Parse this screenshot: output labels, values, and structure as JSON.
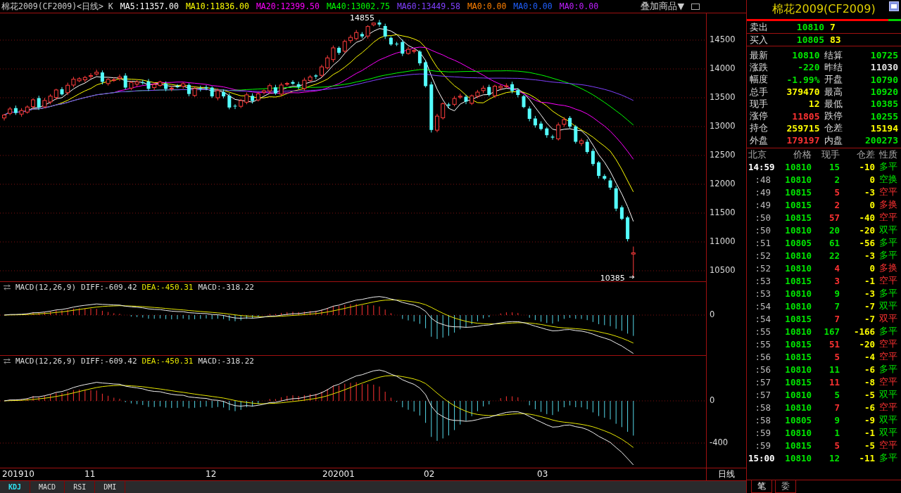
{
  "header": {
    "title": "棉花2009(CF2009)<日线> K",
    "moving_averages": [
      {
        "label": "MA5:11357.00",
        "color": "#ffffff"
      },
      {
        "label": "MA10:11836.00",
        "color": "#ffff00"
      },
      {
        "label": "MA20:12399.50",
        "color": "#ff00ff"
      },
      {
        "label": "MA40:13002.75",
        "color": "#00ff00"
      },
      {
        "label": "MA60:13449.58",
        "color": "#8040ff"
      },
      {
        "label": "MA0:0.00",
        "color": "#ff8000"
      },
      {
        "label": "MA0:0.00",
        "color": "#2060ff"
      },
      {
        "label": "MA0:0.00",
        "color": "#c020ff"
      }
    ],
    "overlay_button": "叠加商品▼"
  },
  "price_chart": {
    "y_ticks": [
      "14500",
      "14000",
      "13500",
      "13000",
      "12500",
      "12000",
      "11500",
      "11000",
      "10500"
    ],
    "high_marker": "14855",
    "low_marker": "10385"
  },
  "indicator_panes": [
    {
      "name": "MACD(12,26,9)",
      "diff": "DIFF:-609.42",
      "dea": "DEA:-450.31",
      "macd": "MACD:-318.22",
      "y_ticks": [
        "0"
      ]
    },
    {
      "name": "MACD(12,26,9)",
      "diff": "DIFF:-609.42",
      "dea": "DEA:-450.31",
      "macd": "MACD:-318.22",
      "y_ticks": [
        "0",
        "-400"
      ]
    }
  ],
  "x_axis": {
    "labels": [
      "201910",
      "11",
      "12",
      "202001",
      "02",
      "03"
    ],
    "period": "日线"
  },
  "indicator_tabs": [
    {
      "label": "KDJ",
      "selected": true
    },
    {
      "label": "MACD",
      "selected": false
    },
    {
      "label": "RSI",
      "selected": false
    },
    {
      "label": "DMI",
      "selected": false
    }
  ],
  "quote": {
    "title": "棉花2009(CF2009)",
    "ratio_bar": {
      "level": 0.92
    },
    "ask": {
      "label": "卖出",
      "price": "10810",
      "volume": "7"
    },
    "bid": {
      "label": "买入",
      "price": "10805",
      "volume": "83"
    },
    "stats": [
      {
        "label": "最新",
        "value": "10810",
        "color": "#00e600"
      },
      {
        "label": "结算",
        "value": "10725",
        "color": "#00e600"
      },
      {
        "label": "涨跌",
        "value": "-220",
        "color": "#00e600"
      },
      {
        "label": "昨结",
        "value": "11030",
        "color": "#e0e0e0"
      },
      {
        "label": "幅度",
        "value": "-1.99%",
        "color": "#00e600"
      },
      {
        "label": "开盘",
        "value": "10790",
        "color": "#00e600"
      },
      {
        "label": "总手",
        "value": "379470",
        "color": "#ffff00"
      },
      {
        "label": "最高",
        "value": "10920",
        "color": "#00e600"
      },
      {
        "label": "现手",
        "value": "12",
        "color": "#ffff00"
      },
      {
        "label": "最低",
        "value": "10385",
        "color": "#00e600"
      },
      {
        "label": "涨停",
        "value": "11805",
        "color": "#ff3232"
      },
      {
        "label": "跌停",
        "value": "10255",
        "color": "#00e600"
      },
      {
        "label": "持仓",
        "value": "259715",
        "color": "#ffff00"
      },
      {
        "label": "仓差",
        "value": "15194",
        "color": "#ffff00"
      },
      {
        "label": "外盘",
        "value": "179197",
        "color": "#ff3232"
      },
      {
        "label": "内盘",
        "value": "200273",
        "color": "#00e600"
      }
    ]
  },
  "ticks": {
    "columns": [
      "北京",
      "价格",
      "现手",
      "仓差",
      "性质"
    ],
    "rows": [
      {
        "time": "14:59",
        "price": "10810",
        "volume": "15",
        "oi_change": "-10",
        "nature": "多平",
        "color": "#00e600",
        "emphasis": true
      },
      {
        "time": ":48",
        "price": "10810",
        "volume": "2",
        "oi_change": "0",
        "nature": "空换",
        "color": "#00e600",
        "emphasis": false
      },
      {
        "time": ":49",
        "price": "10815",
        "volume": "5",
        "oi_change": "-3",
        "nature": "空平",
        "color": "#ff3232",
        "emphasis": false
      },
      {
        "time": ":49",
        "price": "10815",
        "volume": "2",
        "oi_change": "0",
        "nature": "多换",
        "color": "#ff3232",
        "emphasis": false
      },
      {
        "time": ":50",
        "price": "10815",
        "volume": "57",
        "oi_change": "-40",
        "nature": "空平",
        "color": "#ff3232",
        "emphasis": false
      },
      {
        "time": ":50",
        "price": "10810",
        "volume": "20",
        "oi_change": "-20",
        "nature": "双平",
        "color": "#00e600",
        "emphasis": false
      },
      {
        "time": ":51",
        "price": "10805",
        "volume": "61",
        "oi_change": "-56",
        "nature": "多平",
        "color": "#00e600",
        "emphasis": false
      },
      {
        "time": ":52",
        "price": "10810",
        "volume": "22",
        "oi_change": "-3",
        "nature": "多平",
        "color": "#00e600",
        "emphasis": false
      },
      {
        "time": ":52",
        "price": "10810",
        "volume": "4",
        "oi_change": "0",
        "nature": "多换",
        "color": "#ff3232",
        "emphasis": false
      },
      {
        "time": ":53",
        "price": "10815",
        "volume": "3",
        "oi_change": "-1",
        "nature": "空平",
        "color": "#ff3232",
        "emphasis": false
      },
      {
        "time": ":53",
        "price": "10810",
        "volume": "9",
        "oi_change": "-3",
        "nature": "多平",
        "color": "#00e600",
        "emphasis": false
      },
      {
        "time": ":54",
        "price": "10810",
        "volume": "7",
        "oi_change": "-7",
        "nature": "双平",
        "color": "#00e600",
        "emphasis": false
      },
      {
        "time": ":54",
        "price": "10815",
        "volume": "7",
        "oi_change": "-7",
        "nature": "双平",
        "color": "#ff3232",
        "emphasis": false
      },
      {
        "time": ":55",
        "price": "10810",
        "volume": "167",
        "oi_change": "-166",
        "nature": "多平",
        "color": "#00e600",
        "emphasis": false
      },
      {
        "time": ":55",
        "price": "10815",
        "volume": "51",
        "oi_change": "-20",
        "nature": "空平",
        "color": "#ff3232",
        "emphasis": false
      },
      {
        "time": ":56",
        "price": "10815",
        "volume": "5",
        "oi_change": "-4",
        "nature": "空平",
        "color": "#ff3232",
        "emphasis": false
      },
      {
        "time": ":56",
        "price": "10810",
        "volume": "11",
        "oi_change": "-6",
        "nature": "多平",
        "color": "#00e600",
        "emphasis": false
      },
      {
        "time": ":57",
        "price": "10815",
        "volume": "11",
        "oi_change": "-8",
        "nature": "空平",
        "color": "#ff3232",
        "emphasis": false
      },
      {
        "time": ":57",
        "price": "10810",
        "volume": "5",
        "oi_change": "-5",
        "nature": "双平",
        "color": "#00e600",
        "emphasis": false
      },
      {
        "time": ":58",
        "price": "10810",
        "volume": "7",
        "oi_change": "-6",
        "nature": "空平",
        "color": "#ff3232",
        "emphasis": false
      },
      {
        "time": ":58",
        "price": "10805",
        "volume": "9",
        "oi_change": "-9",
        "nature": "双平",
        "color": "#00e600",
        "emphasis": false
      },
      {
        "time": ":59",
        "price": "10810",
        "volume": "1",
        "oi_change": "-1",
        "nature": "双平",
        "color": "#00e600",
        "emphasis": false
      },
      {
        "time": ":59",
        "price": "10815",
        "volume": "5",
        "oi_change": "-5",
        "nature": "空平",
        "color": "#ff3232",
        "emphasis": false
      },
      {
        "time": "15:00",
        "price": "10810",
        "volume": "12",
        "oi_change": "-11",
        "nature": "多平",
        "color": "#00e600",
        "emphasis": true
      }
    ]
  },
  "panel_tabs": [
    {
      "label": "笔",
      "selected": true
    },
    {
      "label": "委",
      "selected": false
    }
  ]
}
